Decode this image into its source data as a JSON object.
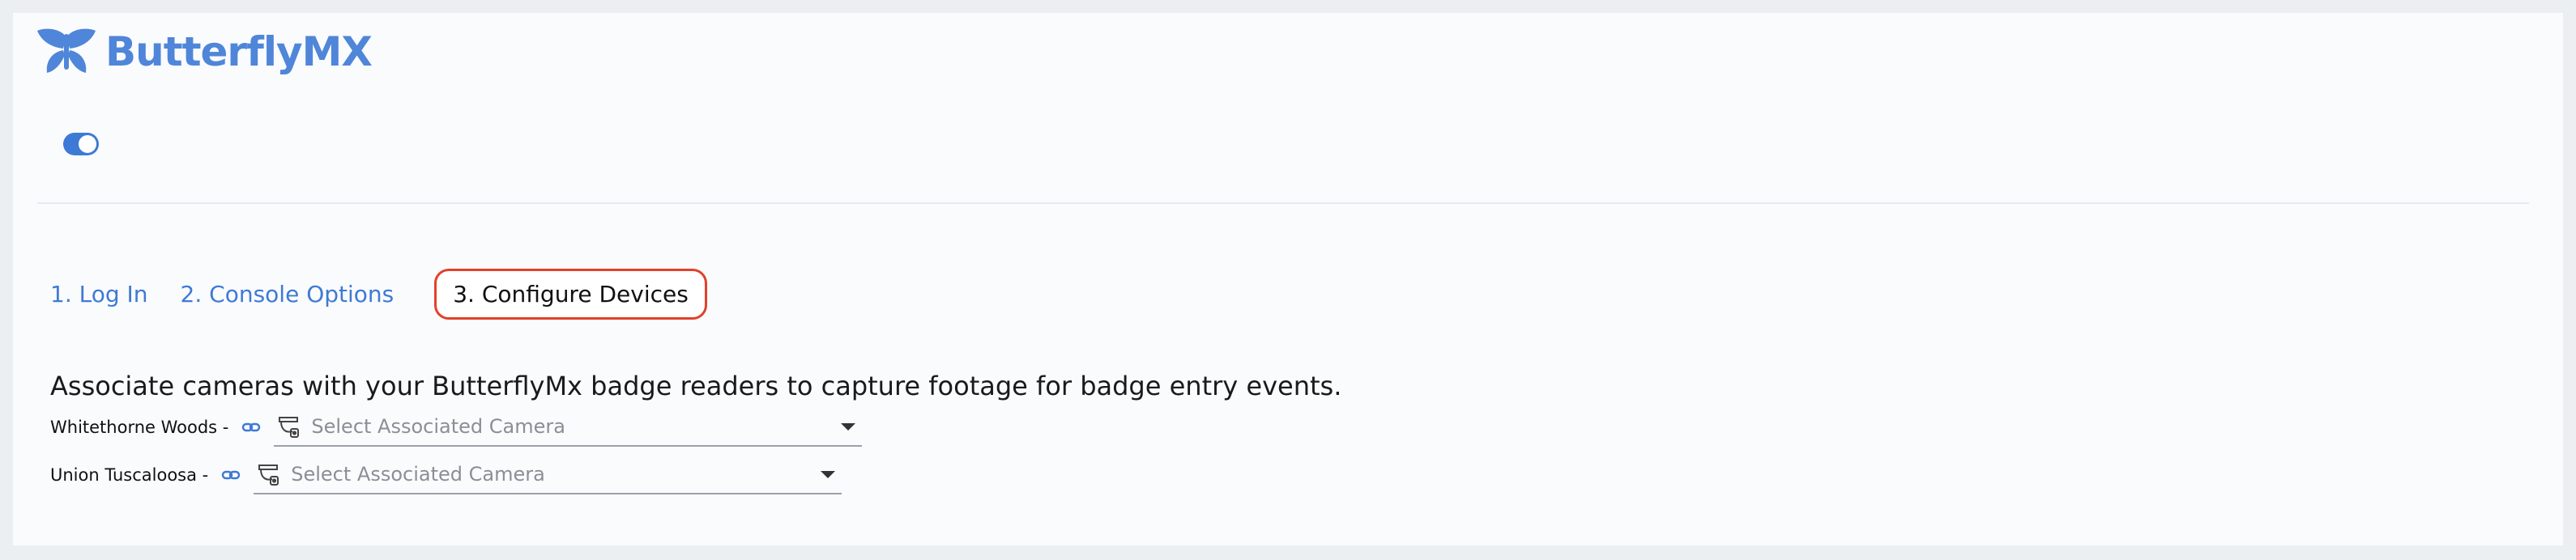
{
  "brand": {
    "name": "ButterflyMX",
    "color": "#4f86d9"
  },
  "toggle": {
    "state": "on"
  },
  "steps": [
    {
      "label": "1. Log In",
      "active": false
    },
    {
      "label": "2. Console Options",
      "active": false
    },
    {
      "label": "3. Configure Devices",
      "active": true
    }
  ],
  "main": {
    "intro": "Associate cameras with your ButterflyMx badge readers to capture footage for badge entry events.",
    "devices": [
      {
        "label": "Whitethorne Woods -",
        "placeholder": "Select Associated Camera",
        "link_icon": "link-icon",
        "camera_icon": "camera-icon"
      },
      {
        "label": "Union Tuscaloosa -",
        "placeholder": "Select Associated Camera",
        "link_icon": "link-icon",
        "camera_icon": "camera-icon"
      }
    ]
  },
  "colors": {
    "accent": "#3f7ad4",
    "active_outline": "#e2412c"
  }
}
